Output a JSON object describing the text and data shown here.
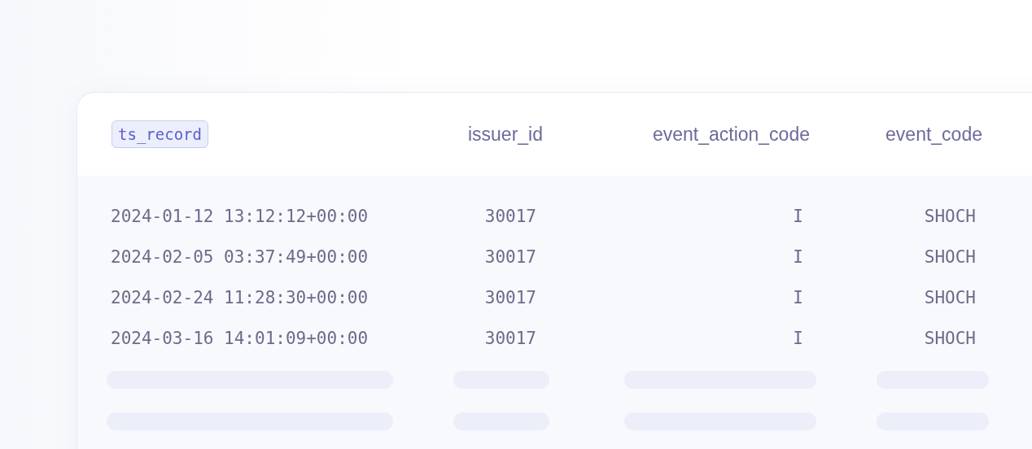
{
  "table": {
    "columns": [
      {
        "label": "ts_record",
        "highlighted": true
      },
      {
        "label": "issuer_id",
        "highlighted": false
      },
      {
        "label": "event_action_code",
        "highlighted": false
      },
      {
        "label": "event_code",
        "highlighted": false
      }
    ],
    "rows": [
      [
        "2024-01-12 13:12:12+00:00",
        "30017",
        "I",
        "SHOCH"
      ],
      [
        "2024-02-05 03:37:49+00:00",
        "30017",
        "I",
        "SHOCH"
      ],
      [
        "2024-02-24 11:28:30+00:00",
        "30017",
        "I",
        "SHOCH"
      ],
      [
        "2024-03-16 14:01:09+00:00",
        "30017",
        "I",
        "SHOCH"
      ]
    ]
  }
}
